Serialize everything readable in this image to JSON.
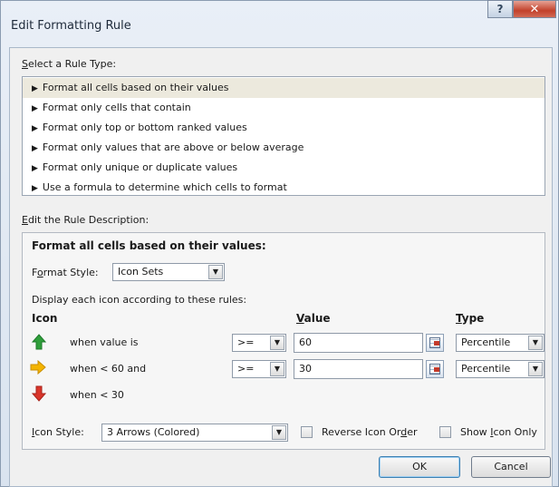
{
  "window": {
    "title": "Edit Formatting Rule",
    "help_glyph": "?",
    "close_glyph": "✕"
  },
  "rule_type": {
    "label_prefix": "S",
    "label_rest": "elect a Rule Type:",
    "items": [
      {
        "label": "Format all cells based on their values",
        "selected": true
      },
      {
        "label": "Format only cells that contain",
        "selected": false
      },
      {
        "label": "Format only top or bottom ranked values",
        "selected": false
      },
      {
        "label": "Format only values that are above or below average",
        "selected": false
      },
      {
        "label": "Format only unique or duplicate values",
        "selected": false
      },
      {
        "label": "Use a formula to determine which cells to format",
        "selected": false
      }
    ]
  },
  "description": {
    "label_prefix": "E",
    "label_rest": "dit the Rule Description:",
    "heading": "Format all cells based on their values:",
    "format_style_label_pre": "F",
    "format_style_label_ul": "o",
    "format_style_label_post": "rmat Style:",
    "format_style_value": "Icon Sets",
    "display_rules_text": "Display each icon according to these rules:",
    "col_icon": "Icon",
    "col_value_ul": "V",
    "col_value_rest": "alue",
    "col_type_ul": "T",
    "col_type_rest": "ype",
    "rows": [
      {
        "icon": "green-up-arrow-icon",
        "color": "#2e9e3a",
        "text": "when value is",
        "operator": ">=",
        "value": "60",
        "type": "Percentile"
      },
      {
        "icon": "yellow-right-arrow-icon",
        "color": "#f4b400",
        "text": "when < 60 and",
        "operator": ">=",
        "value": "30",
        "type": "Percentile"
      },
      {
        "icon": "red-down-arrow-icon",
        "color": "#d9352a",
        "text": "when < 30"
      }
    ],
    "icon_style_label_ul": "I",
    "icon_style_label_rest": "con Style:",
    "icon_style_value": "3 Arrows (Colored)",
    "reverse_label_pre": "Reverse Icon Or",
    "reverse_label_ul": "d",
    "reverse_label_post": "er",
    "show_icon_label_pre": "Show ",
    "show_icon_label_ul": "I",
    "show_icon_label_post": "con Only"
  },
  "buttons": {
    "ok": "OK",
    "cancel": "Cancel"
  }
}
